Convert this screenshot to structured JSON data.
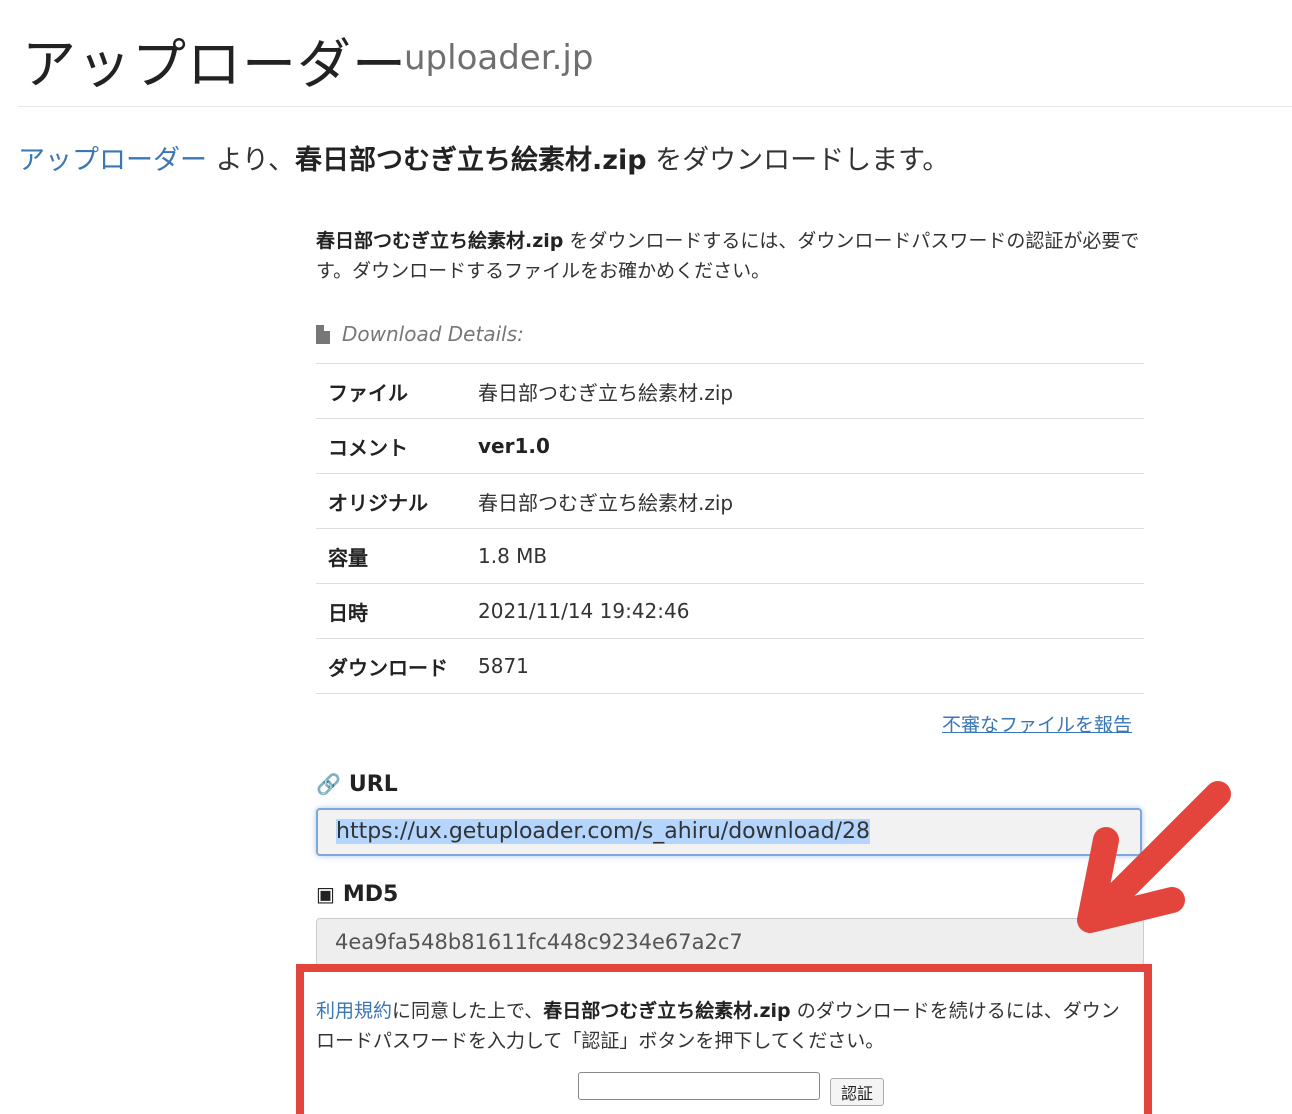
{
  "header": {
    "title": "アップローダー",
    "subtitle": "uploader.jp"
  },
  "lead": {
    "link": "アップローダー",
    "from": " より、",
    "filename": "春日部つむぎ立ち絵素材.zip",
    "suffix": " をダウンロードします。"
  },
  "intro": {
    "filename": "春日部つむぎ立ち絵素材.zip",
    "text": " をダウンロードするには、ダウンロードパスワードの認証が必要です。ダウンロードするファイルをお確かめください。"
  },
  "details": {
    "heading": "Download Details:",
    "icon": "file-icon",
    "rows": [
      {
        "key": "ファイル",
        "value": "春日部つむぎ立ち絵素材.zip"
      },
      {
        "key": "コメント",
        "value": "ver1.0"
      },
      {
        "key": "オリジナル",
        "value": "春日部つむぎ立ち絵素材.zip"
      },
      {
        "key": "容量",
        "value": "1.8 MB"
      },
      {
        "key": "日時",
        "value": "2021/11/14 19:42:46"
      },
      {
        "key": "ダウンロード",
        "value": "5871"
      }
    ],
    "report_link": "不審なファイルを報告"
  },
  "url": {
    "label": "URL",
    "icon": "link-icon",
    "value": "https://ux.getuploader.com/s_ahiru/download/28"
  },
  "md5": {
    "label": "MD5",
    "icon": "file-code-icon",
    "value": "4ea9fa548b81611fc448c9234e67a2c7"
  },
  "auth": {
    "terms_link": "利用規約",
    "text1": "に同意した上で、",
    "filename": "春日部つむぎ立ち絵素材.zip",
    "text2": " のダウンロードを続けるには、ダウンロードパスワードを入力して「認証」ボタンを押下してください。",
    "password_value": "",
    "button_label": "認証",
    "highlight_color": "#e3453c"
  },
  "colors": {
    "link": "#3a77b5",
    "annotation": "#e3453c"
  }
}
